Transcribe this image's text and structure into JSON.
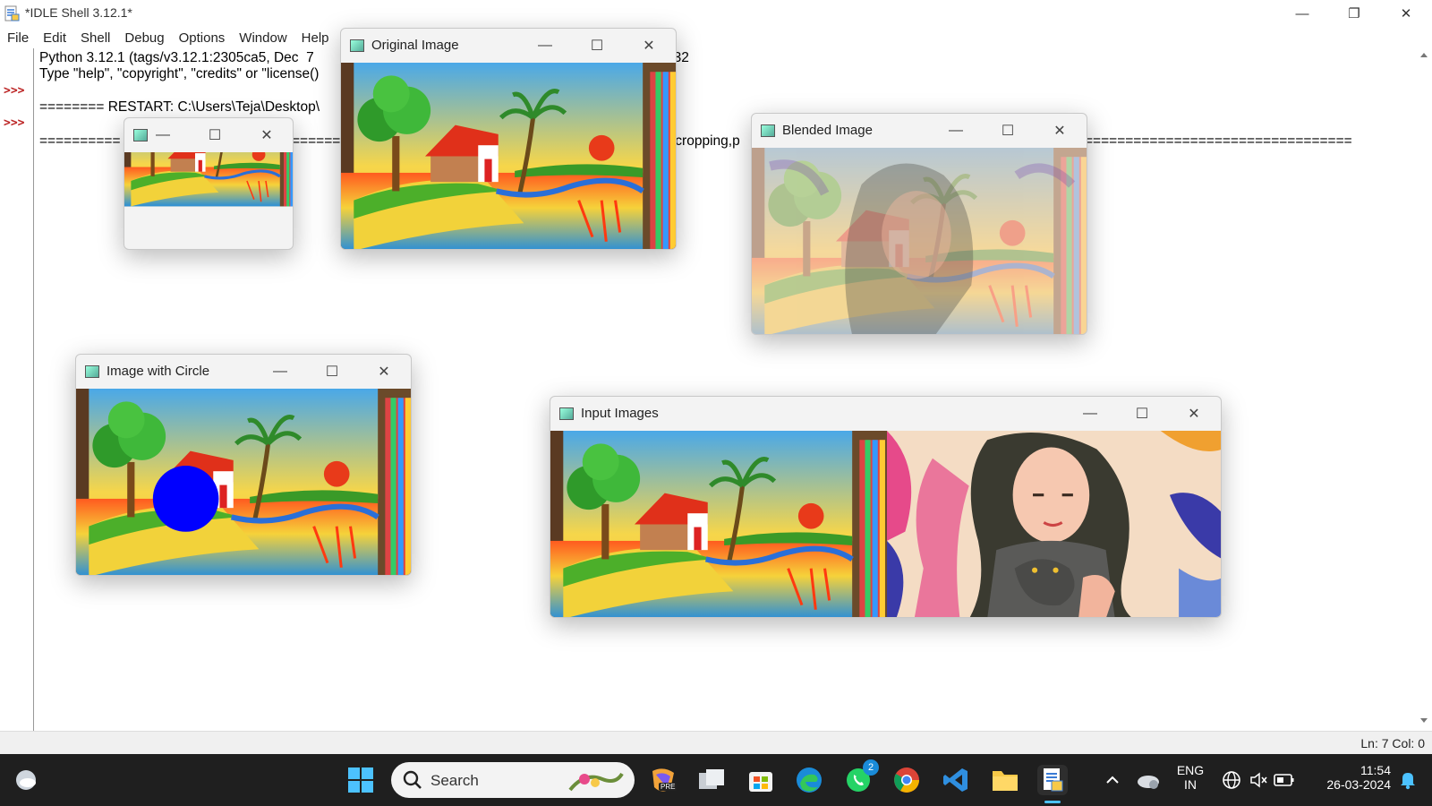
{
  "window": {
    "title": "*IDLE Shell 3.12.1*",
    "minimize": "—",
    "maximize": "❐",
    "close": "✕"
  },
  "menu": [
    "File",
    "Edit",
    "Shell",
    "Debug",
    "Options",
    "Window",
    "Help"
  ],
  "shell": {
    "prompts": [
      ">>>",
      ">>>"
    ],
    "line1": "Python 3.12.1 (tags/v3.12.1:2305ca5, Dec  7",
    "line1_tail": "n32",
    "line2": "Type \"help\", \"copyright\", \"credits\" or \"license()",
    "line3": "======== RESTART: C:\\Users\\Teja\\Desktop\\",
    "line4a": "==========",
    "line4b": "======",
    "line4c": ".cropping,p",
    "line4d": "================================="
  },
  "status": {
    "position": "Ln: 7   Col: 0"
  },
  "cv_windows": {
    "small": {
      "title": ""
    },
    "original": {
      "title": "Original Image"
    },
    "blended": {
      "title": "Blended Image"
    },
    "circle": {
      "title": "Image with Circle"
    },
    "input": {
      "title": "Input Images"
    },
    "controls": {
      "minimize": "—",
      "maximize": "☐",
      "close": "✕"
    }
  },
  "taskbar": {
    "search_label": "Search",
    "whatsapp_badge": "2",
    "lang_top": "ENG",
    "lang_bottom": "IN",
    "time": "11:54",
    "date": "26-03-2024",
    "copilot_badge": "PRE"
  },
  "colors": {
    "prompt": "#b22222",
    "circle": "#0000ff",
    "taskbar": "#1f1f1f"
  }
}
